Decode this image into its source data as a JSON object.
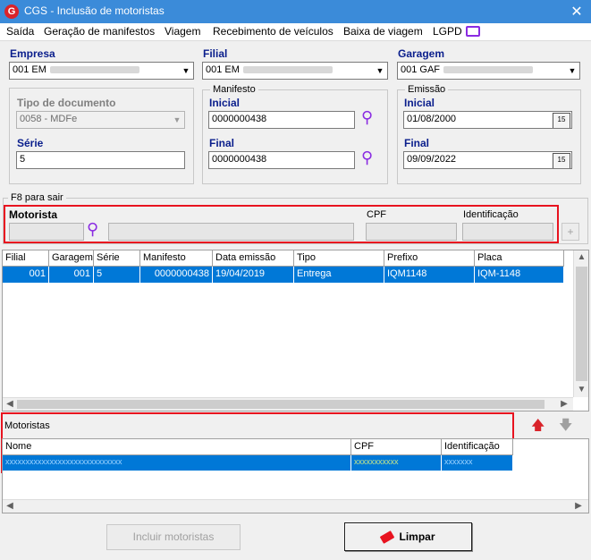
{
  "window": {
    "title": "CGS - Inclusão de motoristas",
    "close_icon": "close-icon"
  },
  "menu": [
    "Saída",
    "Geração de manifestos",
    "Viagem",
    "Recebimento de veículos",
    "Baixa de viagem",
    "LGPD"
  ],
  "filters": {
    "empresa": {
      "label": "Empresa",
      "value": "001 EM"
    },
    "filial": {
      "label": "Filial",
      "value": "001 EM"
    },
    "garagem": {
      "label": "Garagem",
      "value": "001 GAF"
    },
    "tipo_documento": {
      "label": "Tipo de documento",
      "value": "0058 - MDFe"
    },
    "serie": {
      "label": "Série",
      "value": "5"
    },
    "manifesto": {
      "group_title": "Manifesto",
      "inicial_label": "Inicial",
      "inicial": "0000000438",
      "final_label": "Final",
      "final": "0000000438"
    },
    "emissao": {
      "group_title": "Emissão",
      "inicial_label": "Inicial",
      "inicial": "01/08/2000",
      "final_label": "Final",
      "final": "09/09/2022",
      "cal_icon": "15"
    }
  },
  "motorista_section": {
    "group_title": "F8 para sair",
    "motorista_label": "Motorista",
    "cpf_label": "CPF",
    "identificacao_label": "Identificação",
    "add_icon": "+"
  },
  "manifest_grid": {
    "columns": [
      "Filial",
      "Garagem",
      "Série",
      "Manifesto",
      "Data emissão",
      "Tipo",
      "Prefixo",
      "Placa"
    ],
    "rows": [
      {
        "filial": "001",
        "garagem": "001",
        "serie": "5",
        "manifesto": "0000000438",
        "data_emissao": "19/04/2019",
        "tipo": "Entrega",
        "prefixo": "IQM1148",
        "placa": "IQM-1148"
      }
    ]
  },
  "motoristas_grid": {
    "title": "Motoristas",
    "columns": [
      "Nome",
      "CPF",
      "Identificação"
    ],
    "rows": [
      {
        "nome": "xxxxxxxxxxxxxxxxxxxxxxxxxxxxx",
        "cpf": "xxxxxxxxxxx",
        "identificacao": "xxxxxxx"
      }
    ]
  },
  "buttons": {
    "incluir": "Incluir motoristas",
    "limpar": "Limpar"
  },
  "colors": {
    "accent": "#3b8bd9",
    "selection": "#0078d7",
    "highlight": "#e8131f",
    "label": "#0a1e8c"
  }
}
